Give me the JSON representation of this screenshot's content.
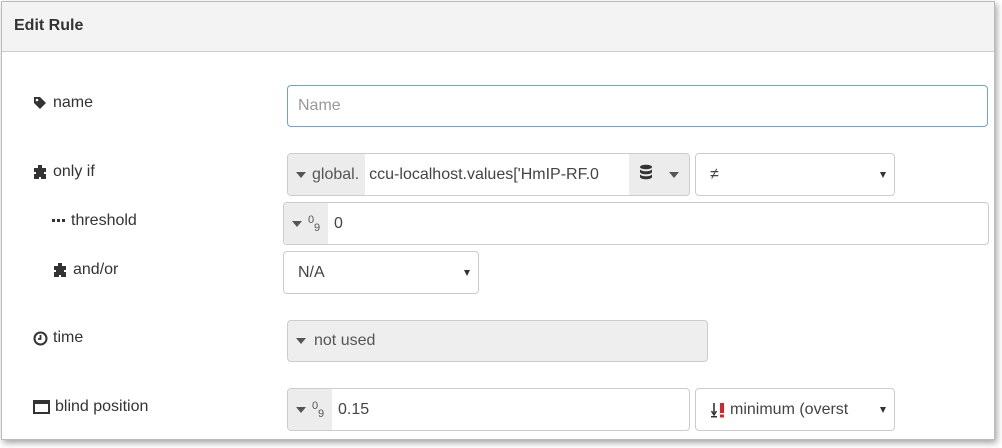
{
  "dialog": {
    "title": "Edit Rule"
  },
  "name_row": {
    "label": "name",
    "placeholder": "Name",
    "value": ""
  },
  "only_if_row": {
    "label": "only if",
    "type_label": "global.",
    "value": "ccu-localhost.values['HmIP-RF.0",
    "operator": "≠"
  },
  "threshold_row": {
    "label": "threshold",
    "value": "0"
  },
  "and_or_row": {
    "label": "and/or",
    "value": "N/A"
  },
  "time_row": {
    "label": "time",
    "value": "not used"
  },
  "blind_position_row": {
    "label": "blind position",
    "value": "0.15",
    "mode": "minimum (overst"
  },
  "icons": {
    "name": "tag-icon",
    "only_if": "puzzle-icon",
    "threshold": "ellipsis-icon",
    "and_or": "puzzle-icon",
    "time": "clock-icon",
    "blind_position": "window-icon",
    "database": "database-icon",
    "mode": "sort-exclamation-icon"
  },
  "colors": {
    "focus_border": "#6fa3d6",
    "alert": "#d9232a"
  }
}
